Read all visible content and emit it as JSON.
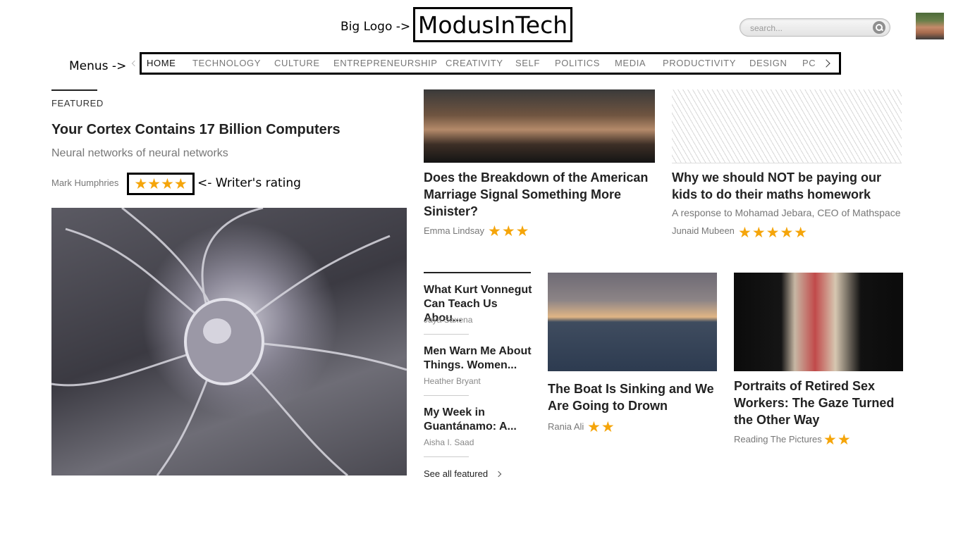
{
  "annotations": {
    "logo_arrow": "Big Logo ->",
    "menu_arrow": "Menus ->",
    "rating_arrow": "<- Writer's rating"
  },
  "header": {
    "logo": "ModusInTech",
    "search_placeholder": "search..."
  },
  "menu": {
    "items": [
      "HOME",
      "TECHNOLOGY",
      "CULTURE",
      "ENTREPRENEURSHIP",
      "CREATIVITY",
      "SELF",
      "POLITICS",
      "MEDIA",
      "PRODUCTIVITY",
      "DESIGN",
      "PC"
    ],
    "active_index": 0
  },
  "featured": {
    "label": "FEATURED",
    "title": "Your Cortex Contains 17 Billion Computers",
    "subtitle": "Neural networks of neural networks",
    "author": "Mark Humphries",
    "rating": 4,
    "stars": "★★★★"
  },
  "articles": [
    {
      "title": "Does the Breakdown of the American Marriage Signal Something More Sinister?",
      "author": "Emma Lindsay",
      "rating": 3,
      "stars": "★★★"
    },
    {
      "title": "Why we should NOT be paying our kids to do their maths homework",
      "subtitle": "A response to Mohamad Jebara, CEO of Mathspace",
      "author": "Junaid Mubeen",
      "rating": 5,
      "stars": "★★★★★"
    },
    {
      "title": "The Boat Is Sinking and We Are Going to Drown",
      "author": "Rania Ali",
      "rating": 2,
      "stars": "★★"
    },
    {
      "title": "Portraits of Retired Sex Workers: The Gaze Turned the Other Way",
      "author": "Reading The Pictures",
      "rating": 2,
      "stars": "★★"
    }
  ],
  "side_list": {
    "items": [
      {
        "title": "What Kurt Vonnegut Can Teach Us Abou...",
        "author": "Jaya Saxena"
      },
      {
        "title": "Men Warn Me About Things. Women...",
        "author": "Heather Bryant"
      },
      {
        "title": "My Week in Guantánamo: A...",
        "author": "Aisha I. Saad"
      }
    ],
    "see_all": "See all featured"
  },
  "colors": {
    "star": "#f5a50a",
    "annotation_border": "#000000"
  }
}
